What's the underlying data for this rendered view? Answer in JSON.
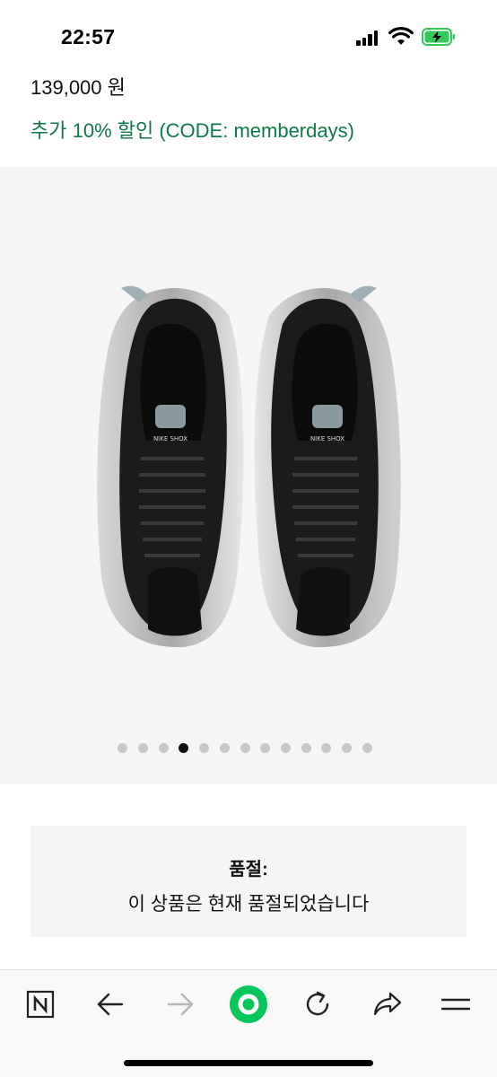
{
  "status_bar": {
    "time": "22:57"
  },
  "product": {
    "price": "139,000 원",
    "promo": "추가 10% 할인 (CODE: memberdays)",
    "image": {
      "shoe_logo_text": "NIKE SHOX"
    },
    "gallery": {
      "image_count": 13,
      "active_index": 3
    }
  },
  "availability": {
    "title": "품절:",
    "message": "이 상품은 현재 품절되었습니다"
  },
  "toolbar": {
    "items": [
      {
        "icon": "naver-n-icon"
      },
      {
        "icon": "back-arrow-icon"
      },
      {
        "icon": "forward-arrow-icon",
        "disabled": true
      },
      {
        "icon": "green-dot-home-icon"
      },
      {
        "icon": "reload-icon"
      },
      {
        "icon": "share-icon"
      },
      {
        "icon": "menu-icon"
      }
    ]
  },
  "colors": {
    "promo_green": "#0e7a45",
    "toolbar_accent": "#03c75a",
    "gallery_bg": "#f5f5f5",
    "battery_green": "#34c759"
  }
}
